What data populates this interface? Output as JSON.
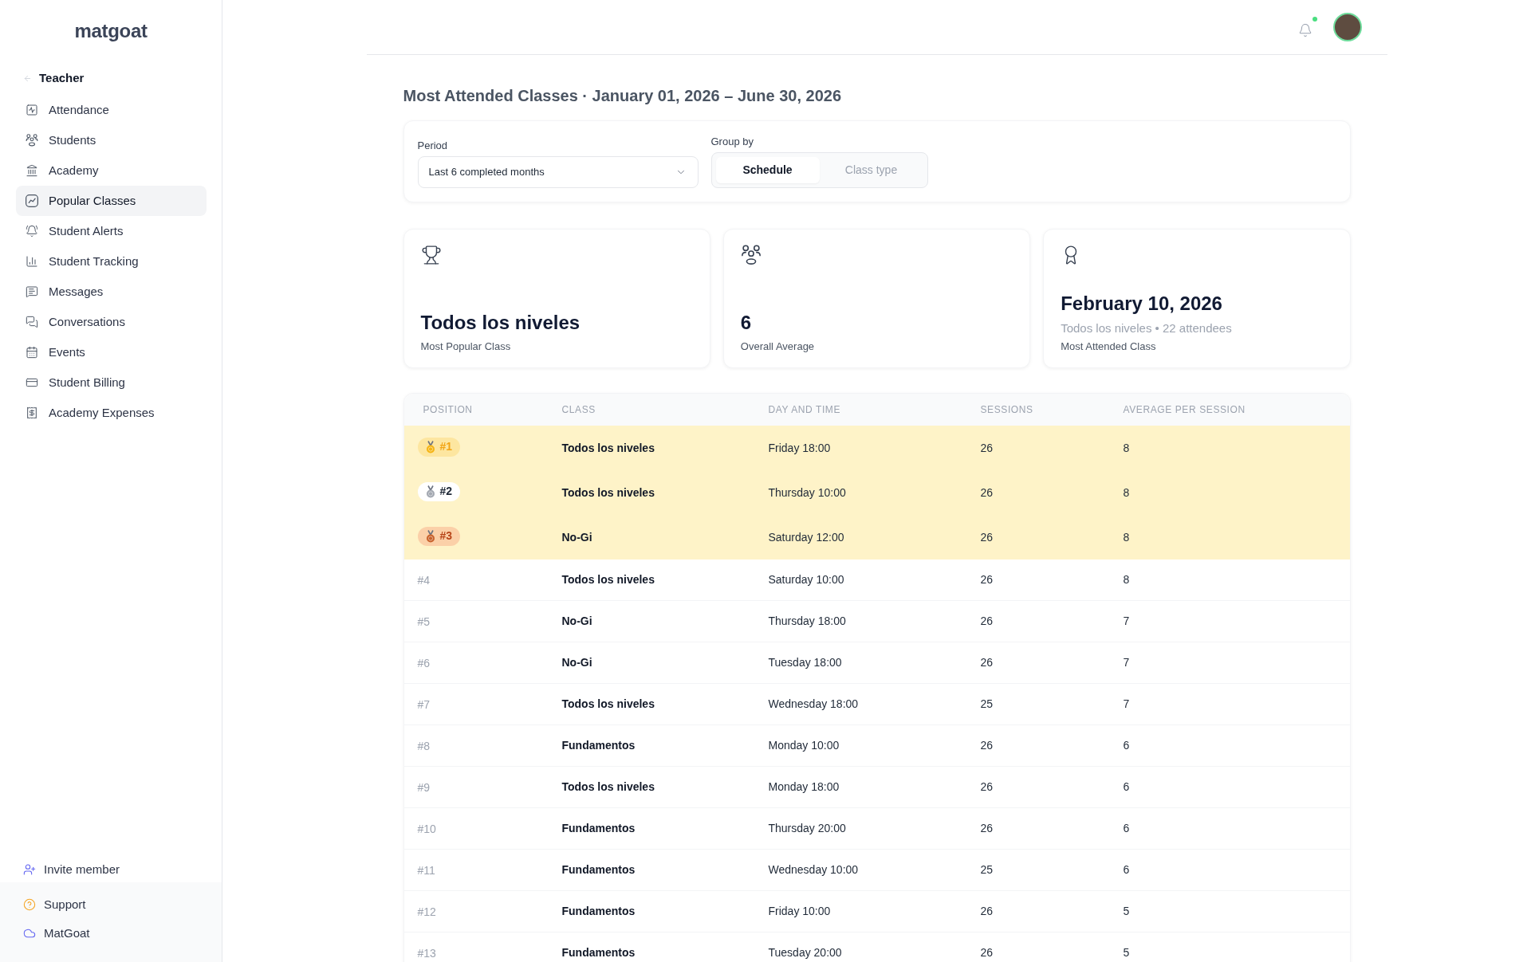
{
  "sidebar": {
    "logo": "matgoat",
    "section": "Teacher",
    "items": [
      {
        "label": "Attendance",
        "selected": false
      },
      {
        "label": "Students",
        "selected": false
      },
      {
        "label": "Academy",
        "selected": false
      },
      {
        "label": "Popular Classes",
        "selected": true
      },
      {
        "label": "Student Alerts",
        "selected": false
      },
      {
        "label": "Student Tracking",
        "selected": false
      },
      {
        "label": "Messages",
        "selected": false
      },
      {
        "label": "Conversations",
        "selected": false
      },
      {
        "label": "Events",
        "selected": false
      },
      {
        "label": "Student Billing",
        "selected": false
      },
      {
        "label": "Academy Expenses",
        "selected": false
      }
    ],
    "footer_items": [
      {
        "label": "Invite member"
      },
      {
        "label": "Support"
      },
      {
        "label": "MatGoat"
      }
    ]
  },
  "header": {
    "notifications": {
      "unread": true
    }
  },
  "page": {
    "title": "Most Attended Classes · January 01, 2026 – June 30, 2026",
    "filters": {
      "period": {
        "label": "Period",
        "value": "Last 6 completed months"
      },
      "group_by": {
        "label": "Group by",
        "options": [
          {
            "label": "Schedule",
            "selected": true
          },
          {
            "label": "Class type",
            "selected": false
          }
        ]
      }
    },
    "stats": [
      {
        "value": "Todos los niveles",
        "label": "Most Popular Class"
      },
      {
        "value": "6",
        "label": "Overall Average"
      },
      {
        "value": "February 10, 2026",
        "detail": "Todos los niveles • 22 attendees",
        "label": "Most Attended Class"
      }
    ],
    "table": {
      "columns": [
        "POSITION",
        "CLASS",
        "DAY AND TIME",
        "SESSIONS",
        "AVERAGE PER SESSION"
      ],
      "rows": [
        {
          "kind": "gold",
          "position": "#1",
          "class": "Todos los niveles",
          "day_time": "Friday 18:00",
          "sessions": "26",
          "average": "8"
        },
        {
          "kind": "silver",
          "position": "#2",
          "class": "Todos los niveles",
          "day_time": "Thursday 10:00",
          "sessions": "26",
          "average": "8"
        },
        {
          "kind": "bronze",
          "position": "#3",
          "class": "No-Gi",
          "day_time": "Saturday 12:00",
          "sessions": "26",
          "average": "8"
        },
        {
          "kind": "plain",
          "position": "#4",
          "class": "Todos los niveles",
          "day_time": "Saturday 10:00",
          "sessions": "26",
          "average": "8"
        },
        {
          "kind": "plain",
          "position": "#5",
          "class": "No-Gi",
          "day_time": "Thursday 18:00",
          "sessions": "26",
          "average": "7"
        },
        {
          "kind": "plain",
          "position": "#6",
          "class": "No-Gi",
          "day_time": "Tuesday 18:00",
          "sessions": "26",
          "average": "7"
        },
        {
          "kind": "plain",
          "position": "#7",
          "class": "Todos los niveles",
          "day_time": "Wednesday 18:00",
          "sessions": "25",
          "average": "7"
        },
        {
          "kind": "plain",
          "position": "#8",
          "class": "Fundamentos",
          "day_time": "Monday 10:00",
          "sessions": "26",
          "average": "6"
        },
        {
          "kind": "plain",
          "position": "#9",
          "class": "Todos los niveles",
          "day_time": "Monday 18:00",
          "sessions": "26",
          "average": "6"
        },
        {
          "kind": "plain",
          "position": "#10",
          "class": "Fundamentos",
          "day_time": "Thursday 20:00",
          "sessions": "26",
          "average": "6"
        },
        {
          "kind": "plain",
          "position": "#11",
          "class": "Fundamentos",
          "day_time": "Wednesday 10:00",
          "sessions": "25",
          "average": "6"
        },
        {
          "kind": "plain",
          "position": "#12",
          "class": "Fundamentos",
          "day_time": "Friday 10:00",
          "sessions": "26",
          "average": "5"
        },
        {
          "kind": "plain",
          "position": "#13",
          "class": "Fundamentos",
          "day_time": "Tuesday 20:00",
          "sessions": "26",
          "average": "5"
        }
      ]
    }
  }
}
